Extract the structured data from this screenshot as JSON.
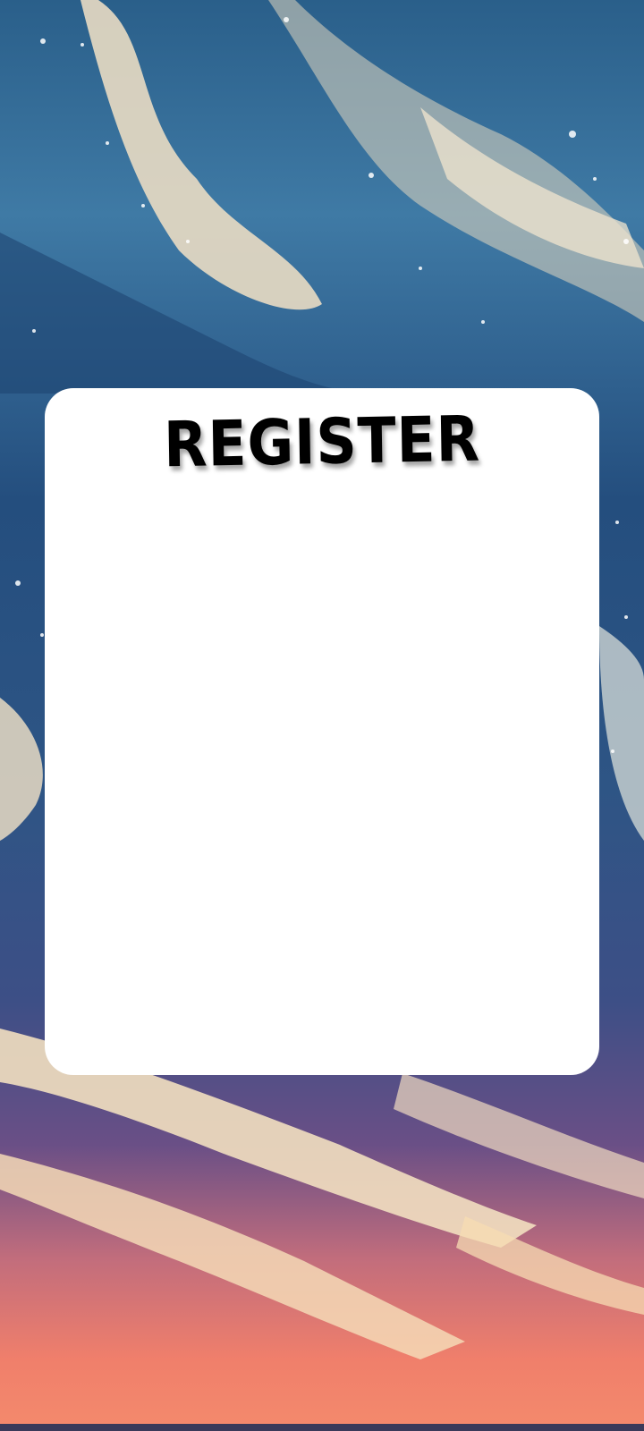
{
  "register_card": {
    "title": "REGISTER"
  },
  "colors": {
    "card_background": "#ffffff",
    "title_color": "#000000",
    "sky_top": "#2a5f8a",
    "sky_bottom": "#f48a6c"
  }
}
